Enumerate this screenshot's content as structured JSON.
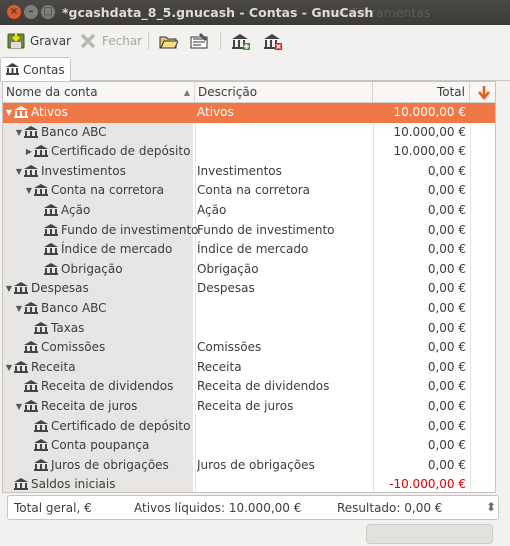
{
  "window": {
    "title": "*gcashdata_8_5.gnucash - Contas - GnuCash",
    "menu_ghost": "rios  Ferramentas"
  },
  "toolbar": {
    "save_label": "Gravar",
    "close_label": "Fechar"
  },
  "tab": {
    "label": "Contas"
  },
  "columns": {
    "name": "Nome da conta",
    "description": "Descrição",
    "total": "Total"
  },
  "accounts": [
    {
      "name": "Ativos",
      "desc": "Ativos",
      "total": "10.000,00 €"
    },
    {
      "name": "Banco ABC",
      "desc": "",
      "total": "10.000,00 €"
    },
    {
      "name": "Certificado de depósito",
      "desc": "",
      "total": "10.000,00 €"
    },
    {
      "name": "Investimentos",
      "desc": "Investimentos",
      "total": "0,00 €"
    },
    {
      "name": "Conta na corretora",
      "desc": "Conta na corretora",
      "total": "0,00 €"
    },
    {
      "name": "Ação",
      "desc": "Ação",
      "total": "0,00 €"
    },
    {
      "name": "Fundo de investimento",
      "desc": "Fundo de investimento",
      "total": "0,00 €"
    },
    {
      "name": "Índice de mercado",
      "desc": "Índice de mercado",
      "total": "0,00 €"
    },
    {
      "name": "Obrigação",
      "desc": "Obrigação",
      "total": "0,00 €"
    },
    {
      "name": "Despesas",
      "desc": "Despesas",
      "total": "0,00 €"
    },
    {
      "name": "Banco ABC",
      "desc": "",
      "total": "0,00 €"
    },
    {
      "name": "Taxas",
      "desc": "",
      "total": "0,00 €"
    },
    {
      "name": "Comissões",
      "desc": "Comissões",
      "total": "0,00 €"
    },
    {
      "name": "Receita",
      "desc": "Receita",
      "total": "0,00 €"
    },
    {
      "name": "Receita de dividendos",
      "desc": "Receita de dividendos",
      "total": "0,00 €"
    },
    {
      "name": "Receita de juros",
      "desc": "Receita de juros",
      "total": "0,00 €"
    },
    {
      "name": "Certificado de depósito",
      "desc": "",
      "total": "0,00 €"
    },
    {
      "name": "Conta poupança",
      "desc": "",
      "total": "0,00 €"
    },
    {
      "name": "Juros de obrigações",
      "desc": "Juros de obrigações",
      "total": "0,00 €"
    },
    {
      "name": "Saldos iniciais",
      "desc": "",
      "total": "-10.000,00 €"
    }
  ],
  "summary": {
    "label": "Total geral, €",
    "net_assets": "Ativos líquidos: 10.000,00 €",
    "result": "Resultado: 0,00 €",
    "spin": "⬍"
  },
  "colors": {
    "selection": "#f07746",
    "negative": "#e00000",
    "close_button": "#e05b2a"
  }
}
